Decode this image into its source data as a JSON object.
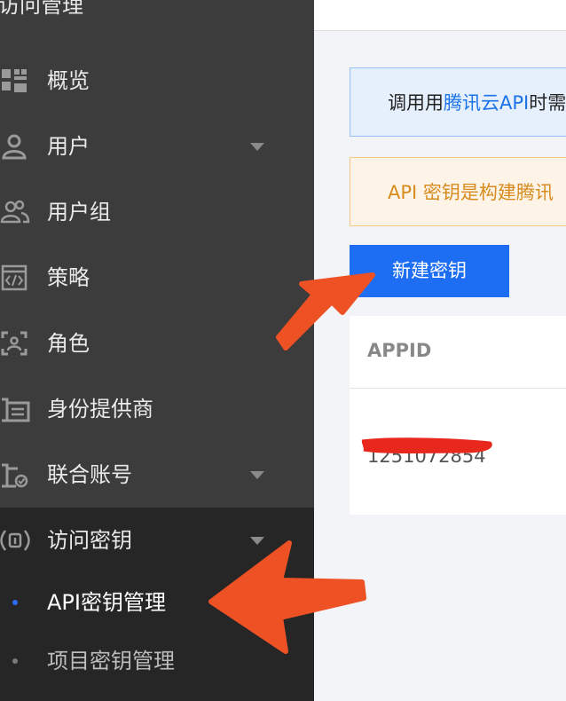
{
  "sidebar": {
    "header_title": "访问管理",
    "items": [
      {
        "label": "概览",
        "icon": "grid-icon"
      },
      {
        "label": "用户",
        "icon": "user-icon",
        "expandable": true
      },
      {
        "label": "用户组",
        "icon": "user-group-icon"
      },
      {
        "label": "策略",
        "icon": "policy-code-icon"
      },
      {
        "label": "角色",
        "icon": "role-icon"
      },
      {
        "label": "身份提供商",
        "icon": "identity-provider-icon"
      },
      {
        "label": "联合账号",
        "icon": "federated-account-icon",
        "expandable": true
      },
      {
        "label": "访问密钥",
        "icon": "key-icon",
        "expandable": true,
        "expanded": true
      }
    ],
    "sub_items": [
      {
        "label": "API密钥管理",
        "active": true
      },
      {
        "label": "项目密钥管理",
        "active": false
      }
    ]
  },
  "main": {
    "info_banner": {
      "prefix": "调用用",
      "link": "腾讯云API",
      "suffix": "时需"
    },
    "warning_banner": "API 密钥是构建腾讯",
    "create_button": "新建密钥",
    "table": {
      "columns": [
        "APPID"
      ],
      "rows": [
        [
          "1251072854"
        ]
      ]
    }
  },
  "colors": {
    "sidebar_bg": "#3c3c3c",
    "sidebar_active_bg": "#262626",
    "primary": "#1d6ef2",
    "annotation_arrow": "#ee5124",
    "redaction": "#e8281d"
  }
}
